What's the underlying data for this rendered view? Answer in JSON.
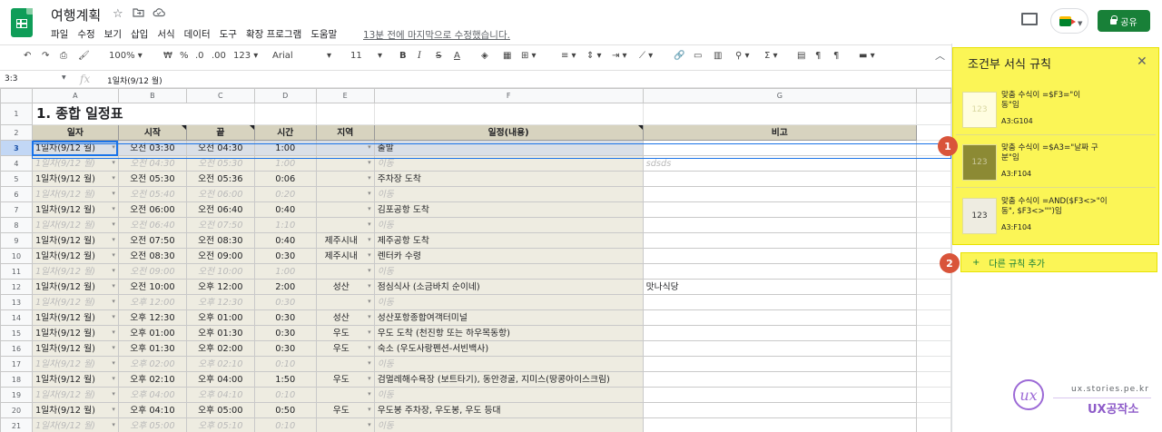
{
  "doc": {
    "title": "여행계획",
    "last_edit": "13분 전에 마지막으로 수정했습니다.",
    "share_label": "공유"
  },
  "menu": [
    "파일",
    "수정",
    "보기",
    "삽입",
    "서식",
    "데이터",
    "도구",
    "확장 프로그램",
    "도움말"
  ],
  "toolbar": {
    "zoom": "100%",
    "currency": "₩",
    "percent": "%",
    "dec_less": ".0",
    "dec_more": ".00",
    "format_more": "123",
    "font": "Arial",
    "font_size": "11"
  },
  "formula_bar": {
    "cell_ref": "3:3",
    "fx": "fx",
    "value": "1일차(9/12 월)"
  },
  "columns": [
    "A",
    "B",
    "C",
    "D",
    "E",
    "F",
    "G"
  ],
  "title_cell": "1. 종합 일정표",
  "headers": [
    "일자",
    "시작",
    "끝",
    "시간",
    "지역",
    "일정(내용)",
    "비고"
  ],
  "rows": [
    {
      "num": "3",
      "type": "main",
      "active": true,
      "a": "1일차(9/12 월)",
      "b": "오전 03:30",
      "c": "오전 04:30",
      "d": "1:00",
      "e": "",
      "f": "출발",
      "g": ""
    },
    {
      "num": "4",
      "type": "ghost",
      "a": "1일차(9/12 월)",
      "b": "오전 04:30",
      "c": "오전 05:30",
      "d": "1:00",
      "e": "",
      "f": "이동",
      "g": "sdsds"
    },
    {
      "num": "5",
      "type": "main",
      "a": "1일차(9/12 월)",
      "b": "오전 05:30",
      "c": "오전 05:36",
      "d": "0:06",
      "e": "",
      "f": "주차장 도착",
      "g": ""
    },
    {
      "num": "6",
      "type": "ghost",
      "a": "1일차(9/12 월)",
      "b": "오전 05:40",
      "c": "오전 06:00",
      "d": "0:20",
      "e": "",
      "f": "이동",
      "g": ""
    },
    {
      "num": "7",
      "type": "main",
      "a": "1일차(9/12 월)",
      "b": "오전 06:00",
      "c": "오전 06:40",
      "d": "0:40",
      "e": "",
      "f": "김포공항 도착",
      "g": ""
    },
    {
      "num": "8",
      "type": "ghost",
      "a": "1일차(9/12 월)",
      "b": "오전 06:40",
      "c": "오전 07:50",
      "d": "1:10",
      "e": "",
      "f": "이동",
      "g": ""
    },
    {
      "num": "9",
      "type": "main",
      "a": "1일차(9/12 월)",
      "b": "오전 07:50",
      "c": "오전 08:30",
      "d": "0:40",
      "e": "제주시내",
      "f": "제주공항 도착",
      "g": ""
    },
    {
      "num": "10",
      "type": "main",
      "a": "1일차(9/12 월)",
      "b": "오전 08:30",
      "c": "오전 09:00",
      "d": "0:30",
      "e": "제주시내",
      "f": "렌터카 수령",
      "g": ""
    },
    {
      "num": "11",
      "type": "ghost",
      "a": "1일차(9/12 월)",
      "b": "오전 09:00",
      "c": "오전 10:00",
      "d": "1:00",
      "e": "",
      "f": "이동",
      "g": ""
    },
    {
      "num": "12",
      "type": "main",
      "a": "1일차(9/12 월)",
      "b": "오전 10:00",
      "c": "오후 12:00",
      "d": "2:00",
      "e": "성산",
      "f": "점심식사 (소금바치 순이네)",
      "g": "맛나식당"
    },
    {
      "num": "13",
      "type": "ghost",
      "a": "1일차(9/12 월)",
      "b": "오후 12:00",
      "c": "오후 12:30",
      "d": "0:30",
      "e": "",
      "f": "이동",
      "g": ""
    },
    {
      "num": "14",
      "type": "main",
      "a": "1일차(9/12 월)",
      "b": "오후 12:30",
      "c": "오후 01:00",
      "d": "0:30",
      "e": "성산",
      "f": "성산포항종합여객터미널",
      "g": ""
    },
    {
      "num": "15",
      "type": "main",
      "a": "1일차(9/12 월)",
      "b": "오후 01:00",
      "c": "오후 01:30",
      "d": "0:30",
      "e": "우도",
      "f": "우도 도착 (천진항 또는 하우목동항)",
      "g": ""
    },
    {
      "num": "16",
      "type": "main",
      "a": "1일차(9/12 월)",
      "b": "오후 01:30",
      "c": "오후 02:00",
      "d": "0:30",
      "e": "우도",
      "f": "숙소 (우도사랑펜션-서빈백사)",
      "g": ""
    },
    {
      "num": "17",
      "type": "ghost",
      "a": "1일차(9/12 월)",
      "b": "오후 02:00",
      "c": "오후 02:10",
      "d": "0:10",
      "e": "",
      "f": "이동",
      "g": ""
    },
    {
      "num": "18",
      "type": "main",
      "a": "1일차(9/12 월)",
      "b": "오후 02:10",
      "c": "오후 04:00",
      "d": "1:50",
      "e": "우도",
      "f": "검멀레해수욕장 (보트타기), 동안경굴, 지미스(땅콩아이스크림)",
      "g": ""
    },
    {
      "num": "19",
      "type": "ghost",
      "a": "1일차(9/12 월)",
      "b": "오후 04:00",
      "c": "오후 04:10",
      "d": "0:10",
      "e": "",
      "f": "이동",
      "g": ""
    },
    {
      "num": "20",
      "type": "main",
      "a": "1일차(9/12 월)",
      "b": "오후 04:10",
      "c": "오후 05:00",
      "d": "0:50",
      "e": "우도",
      "f": "우도봉 주차장, 우도봉, 우도 등대",
      "g": ""
    },
    {
      "num": "21",
      "type": "ghost",
      "a": "1일차(9/12 월)",
      "b": "오후 05:00",
      "c": "오후 05:10",
      "d": "0:10",
      "e": "",
      "f": "이동",
      "g": ""
    }
  ],
  "panel": {
    "title": "조건부 서식 규칙",
    "rules": [
      {
        "swatch": "123",
        "text": "맞춤 수식이 =$F3=\"이동\"임",
        "range": "A3:G104",
        "bg": "#fffde0",
        "fg": "#d8d6a0"
      },
      {
        "swatch": "123",
        "text": "맞춤 수식이 =$A3=\"날짜 구분\"임",
        "range": "A3:F104",
        "bg": "#8c8a34",
        "fg": "#c9c79a"
      },
      {
        "swatch": "123",
        "text": "맞춤 수식이 =AND($F3<>\"이동\", $F3<>\"\")임",
        "range": "A3:F104",
        "bg": "#eeece1",
        "fg": "#333333"
      }
    ],
    "add_rule": "다른 규칙 추가"
  },
  "markers": [
    "1",
    "2"
  ],
  "watermark": {
    "url": "ux.stories.pe.kr",
    "name": "UX공작소"
  }
}
